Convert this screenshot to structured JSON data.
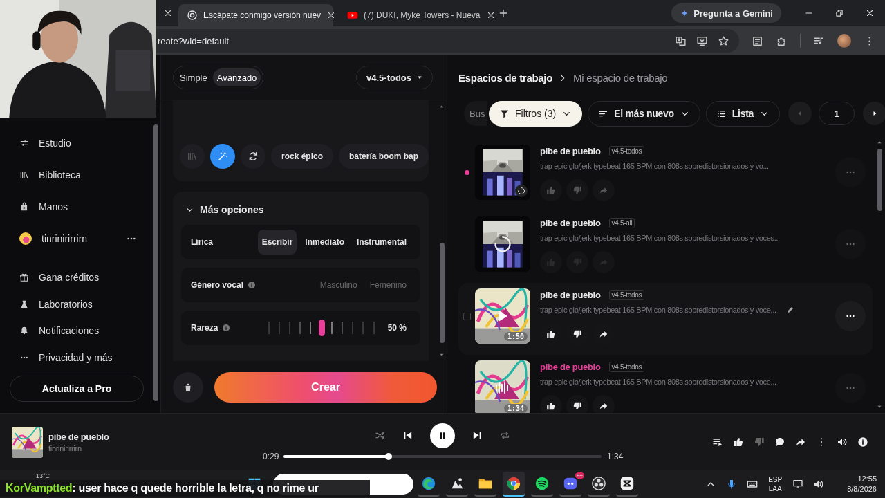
{
  "browser": {
    "tabs": [
      {
        "title": "Escápate conmigo versión nuev",
        "kind": "chat",
        "selected": true
      },
      {
        "title": "(7) DUKI, Myke Towers - Nueva",
        "kind": "video",
        "selected": false
      }
    ],
    "assistant": "Pregunta a Gemini",
    "address": "reate?wid=default"
  },
  "sidebar": {
    "items": [
      "Estudio",
      "Biblioteca",
      "Manos"
    ],
    "user": "tinrinirirrirn",
    "more_items": [
      "Gana créditos",
      "Laboratorios",
      "Notificaciones",
      "Privacidad y más"
    ],
    "upgrade": "Actualiza a Pro"
  },
  "create": {
    "modes": [
      {
        "label": "Simple",
        "selected": false
      },
      {
        "label": "Avanzado",
        "selected": true
      }
    ],
    "model": "v4.5-todos",
    "tools": [
      {
        "selected": false,
        "disabled": true
      },
      {
        "selected": true,
        "disabled": false
      },
      {
        "selected": false,
        "disabled": false
      }
    ],
    "tags": [
      "rock épico",
      "batería boom bap"
    ],
    "options_title": "Más opciones",
    "options_expanded": true,
    "lyrics": {
      "label": "Lírica",
      "options": [
        {
          "label": "Escribir",
          "selected": true
        },
        {
          "label": "Inmediato",
          "selected": false
        },
        {
          "label": "Instrumental",
          "selected": false
        }
      ]
    },
    "vocal": {
      "label": "Género vocal",
      "options": [
        {
          "label": "Masculino",
          "selected": false
        },
        {
          "label": "Femenino",
          "selected": false
        }
      ]
    },
    "weirdness": {
      "label": "Rareza",
      "level": 0.5,
      "reading": "50 %"
    },
    "submit": "Crear"
  },
  "workspace": {
    "breadcrumb": [
      "Espacios de trabajo",
      "Mi espacio de trabajo"
    ],
    "search_placeholder": "Bus",
    "filters": "Filtros (3)",
    "sort": "El más nuevo",
    "view": "Lista",
    "page": "1",
    "songs": [
      {
        "title": "pibe de pueblo",
        "version": "v4.5-todos",
        "description": "trap epic glo/jerk typebeat 165 BPM con 808s sobredistorsionados y vo...",
        "kind": "generating",
        "new": true,
        "hovered": false,
        "playing": false
      },
      {
        "title": "pibe de pueblo",
        "version": "v4.5-all",
        "description": "trap epic glo/jerk typebeat 165 BPM con 808s sobredistorsionados y voces...",
        "kind": "queued",
        "new": false,
        "hovered": false,
        "playing": false
      },
      {
        "title": "pibe de pueblo",
        "version": "v4.5-todos",
        "description": "trap epic glo/jerk typebeat 165 BPM con 808s sobredistorsionados y voce...",
        "kind": "ready",
        "duration": "1:50",
        "new": false,
        "hovered": true,
        "playing": false
      },
      {
        "title": "pibe de pueblo",
        "version": "v4.5-todos",
        "description": "trap epic glo/jerk typebeat 165 BPM con 808s sobredistorsionados y voce...",
        "kind": "ready",
        "duration": "1:34",
        "new": false,
        "hovered": false,
        "playing": true
      }
    ]
  },
  "player": {
    "title": "pibe de pueblo",
    "artist": "tinrinirirrirn",
    "playing": true,
    "current": "0:29",
    "total": "1:34",
    "level": 0.33
  },
  "taskbar": {
    "weather": "13°C",
    "apps": [
      {
        "selected": false
      },
      {
        "selected": false
      },
      {
        "selected": false
      },
      {
        "selected": true
      },
      {
        "selected": false
      },
      {
        "selected": false,
        "badge": "9+"
      },
      {
        "selected": false
      },
      {
        "selected": false
      }
    ],
    "language": "ESP",
    "layout": "LAA",
    "time": "12:55",
    "date": "8/8/2026"
  },
  "chat": {
    "user": "KorVamptted",
    "message": ": user hace q quede horrible la letra, q no rime ur"
  }
}
